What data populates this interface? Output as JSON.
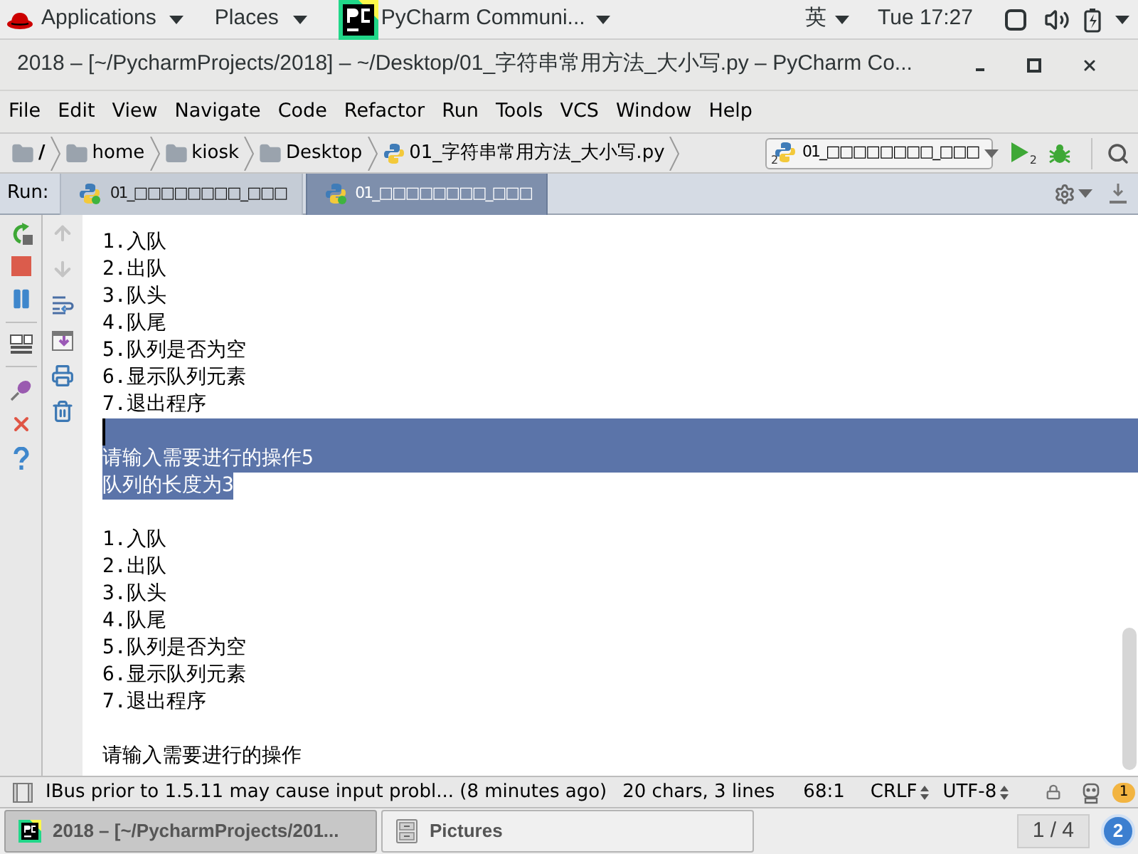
{
  "top_bar": {
    "menus": [
      {
        "label": "Applications"
      },
      {
        "label": "Places"
      }
    ],
    "app": {
      "label": "PyCharm Communi..."
    },
    "input_method": "英",
    "clock": "Tue 17:27"
  },
  "window": {
    "title": "2018 – [~/PycharmProjects/2018] – ~/Desktop/01_字符串常用方法_大小写.py – PyCharm Co..."
  },
  "menu_bar": [
    "File",
    "Edit",
    "View",
    "Navigate",
    "Code",
    "Refactor",
    "Run",
    "Tools",
    "VCS",
    "Window",
    "Help"
  ],
  "navigation_bar": {
    "breadcrumbs": [
      {
        "label": "/",
        "kind": "folder"
      },
      {
        "label": "home",
        "kind": "folder"
      },
      {
        "label": "kiosk",
        "kind": "folder"
      },
      {
        "label": "Desktop",
        "kind": "folder"
      },
      {
        "label": "01_字符串常用方法_大小写.py",
        "kind": "file"
      }
    ],
    "run_config": {
      "label": "01_□□□□□□□□_□□□",
      "count": "2"
    },
    "run_count": "2"
  },
  "run_panel": {
    "label": "Run:",
    "tabs": [
      {
        "label": "01_□□□□□□□□_□□□",
        "selected": false
      },
      {
        "label": "01_□□□□□□□□_□□□",
        "selected": true
      }
    ],
    "console_toolbar": [
      {
        "kind": "up",
        "disabled": true
      },
      {
        "kind": "down",
        "disabled": true
      },
      {
        "kind": "soft-wrap",
        "disabled": false
      },
      {
        "kind": "scroll-to-end",
        "disabled": false
      },
      {
        "kind": "print",
        "disabled": false
      },
      {
        "kind": "clear",
        "disabled": false
      }
    ],
    "console": [
      {
        "text": "1.入队",
        "selected": false,
        "caret": false
      },
      {
        "text": "2.出队",
        "selected": false,
        "caret": false
      },
      {
        "text": "3.队头",
        "selected": false,
        "caret": false
      },
      {
        "text": "4.队尾",
        "selected": false,
        "caret": false
      },
      {
        "text": "5.队列是否为空",
        "selected": false,
        "caret": false
      },
      {
        "text": "6.显示队列元素",
        "selected": false,
        "caret": false
      },
      {
        "text": "7.退出程序",
        "selected": false,
        "caret": false
      },
      {
        "selected": true,
        "caret": true
      },
      {
        "text": "请输入需要进行的操作5",
        "selected": true,
        "caret": false
      },
      {
        "text": "队列的长度为3",
        "selected": true,
        "caret": false
      },
      {
        "selected": false,
        "caret": false
      },
      {
        "text": "1.入队",
        "selected": false,
        "caret": false
      },
      {
        "text": "2.出队",
        "selected": false,
        "caret": false
      },
      {
        "text": "3.队头",
        "selected": false,
        "caret": false
      },
      {
        "text": "4.队尾",
        "selected": false,
        "caret": false
      },
      {
        "text": "5.队列是否为空",
        "selected": false,
        "caret": false
      },
      {
        "text": "6.显示队列元素",
        "selected": false,
        "caret": false
      },
      {
        "text": "7.退出程序",
        "selected": false,
        "caret": false
      },
      {
        "selected": false,
        "caret": false
      },
      {
        "text": "请输入需要进行的操作",
        "selected": false,
        "caret": false
      }
    ]
  },
  "status_bar": {
    "message": "IBus prior to 1.5.11 may cause input probl... (8 minutes ago)",
    "selection": "20 chars, 3 lines",
    "position": "68:1",
    "line_separator": "CRLF",
    "encoding": "UTF-8",
    "notifications": "1"
  },
  "taskbar": {
    "tasks": [
      {
        "label": "2018 – [~/PycharmProjects/201...",
        "kind": "pycharm",
        "selected": true
      },
      {
        "label": "Pictures",
        "kind": "files",
        "selected": false
      }
    ],
    "workspace": "1 / 4",
    "badge": "2"
  }
}
